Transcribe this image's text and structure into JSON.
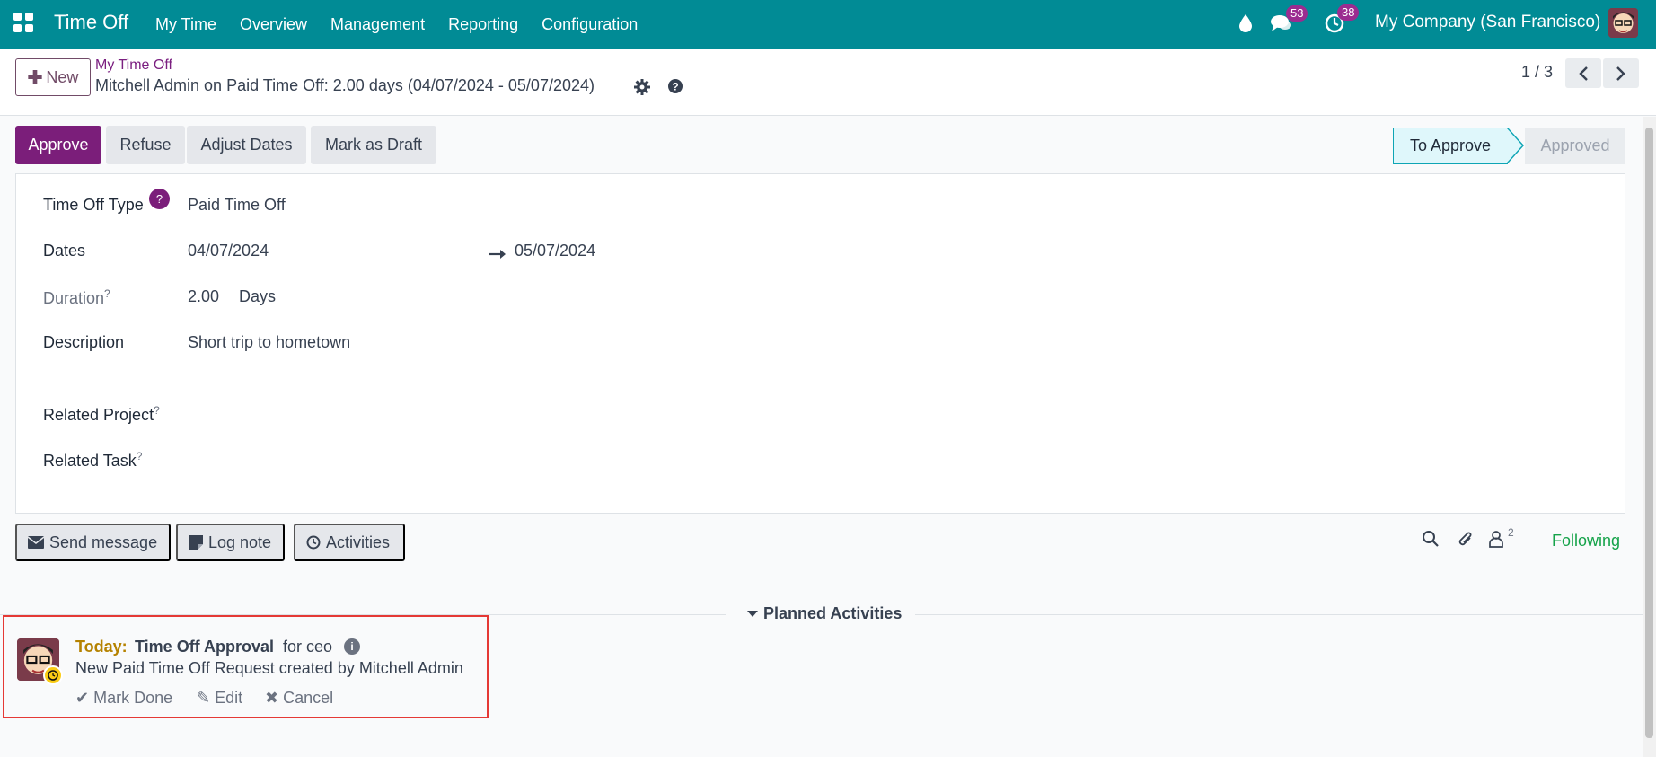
{
  "topbar": {
    "app_title": "Time Off",
    "menu": [
      "My Time",
      "Overview",
      "Management",
      "Reporting",
      "Configuration"
    ],
    "messages_count": "53",
    "activities_count": "38",
    "company": "My Company (San Francisco)"
  },
  "control_panel": {
    "new_label": "New",
    "breadcrumb_parent": "My Time Off",
    "record_title": "Mitchell Admin on Paid Time Off: 2.00 days (04/07/2024 - 05/07/2024)",
    "pager": "1 / 3"
  },
  "statusbar": {
    "approve": "Approve",
    "refuse": "Refuse",
    "adjust": "Adjust Dates",
    "draft": "Mark as Draft",
    "stage_current": "To Approve",
    "stage_next": "Approved"
  },
  "form": {
    "type_label": "Time Off Type",
    "type_help": "?",
    "type_value": "Paid Time Off",
    "dates_label": "Dates",
    "date_from": "04/07/2024",
    "date_to": "05/07/2024",
    "duration_label": "Duration",
    "duration_value": "2.00",
    "duration_unit": "Days",
    "description_label": "Description",
    "description_value": "Short trip to hometown",
    "project_label": "Related Project",
    "task_label": "Related Task",
    "help_mark": "?"
  },
  "chatter": {
    "send_message": "Send message",
    "log_note": "Log note",
    "activities": "Activities",
    "followers_count": "2",
    "following": "Following",
    "planned_title": "Planned Activities"
  },
  "activity": {
    "when": "Today:",
    "type": "Time Off Approval",
    "assignee": "for ceo",
    "summary": "New Paid Time Off Request created by Mitchell Admin",
    "mark_done": "Mark Done",
    "edit": "Edit",
    "cancel": "Cancel"
  }
}
